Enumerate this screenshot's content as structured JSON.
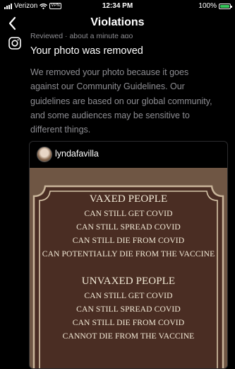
{
  "status_bar": {
    "carrier": "Verizon",
    "vpn": "VPN",
    "time": "12:34 PM",
    "battery": "100%"
  },
  "nav": {
    "title": "Violations"
  },
  "notification": {
    "meta": "Reviewed · about a minute ago",
    "title": "Your photo was removed",
    "body_lines": [
      "We removed your photo because it goes",
      "against our Community Guidelines. Our",
      "guidelines are based on our global community,",
      "and some audiences may be sensitive to",
      "different things."
    ]
  },
  "post": {
    "username": "lyndafavilla",
    "plaque": {
      "heading_1": "VAXED PEOPLE",
      "lines_1": [
        "CAN STILL GET COVID",
        "CAN STILL SPREAD COVID",
        "CAN STILL DIE FROM COVID",
        "CAN POTENTIALLY DIE FROM THE VACCINE"
      ],
      "heading_2": "UNVAXED PEOPLE",
      "lines_2": [
        "CAN STILL GET COVID",
        "CAN STILL SPREAD COVID",
        "CAN STILL DIE FROM  COVID",
        "CANNOT DIE FROM THE VACCINE"
      ]
    }
  },
  "icons": {
    "back": "chevron-left-icon",
    "instagram": "instagram-icon",
    "wifi": "wifi-icon",
    "battery": "battery-icon"
  }
}
